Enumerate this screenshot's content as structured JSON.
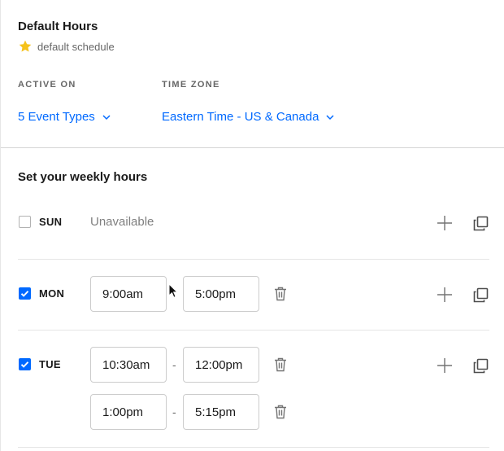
{
  "header": {
    "title": "Default Hours",
    "subtitle": "default schedule",
    "active_on_label": "ACTIVE ON",
    "active_on_value": "5 Event Types",
    "time_zone_label": "TIME ZONE",
    "time_zone_value": "Eastern Time - US & Canada"
  },
  "weekly": {
    "title": "Set your weekly hours",
    "days": [
      {
        "label": "SUN",
        "checked": false,
        "status": "Unavailable",
        "ranges": []
      },
      {
        "label": "MON",
        "checked": true,
        "ranges": [
          {
            "start": "9:00am",
            "end": "5:00pm"
          }
        ]
      },
      {
        "label": "TUE",
        "checked": true,
        "ranges": [
          {
            "start": "10:30am",
            "end": "12:00pm"
          },
          {
            "start": "1:00pm",
            "end": "5:15pm"
          }
        ]
      }
    ],
    "range_separator": "-"
  },
  "icons": {
    "default_marker": "star-icon",
    "dropdown": "chevron-down-icon",
    "add": "plus-icon",
    "copy": "copy-icon",
    "delete": "trash-icon",
    "check": "check-icon",
    "pointer": "mouse-cursor-icon"
  },
  "colors": {
    "accent": "#0069ff",
    "star": "#f5c21b",
    "text": "#1a1a1a",
    "muted": "#666666",
    "border": "#cccccc"
  }
}
